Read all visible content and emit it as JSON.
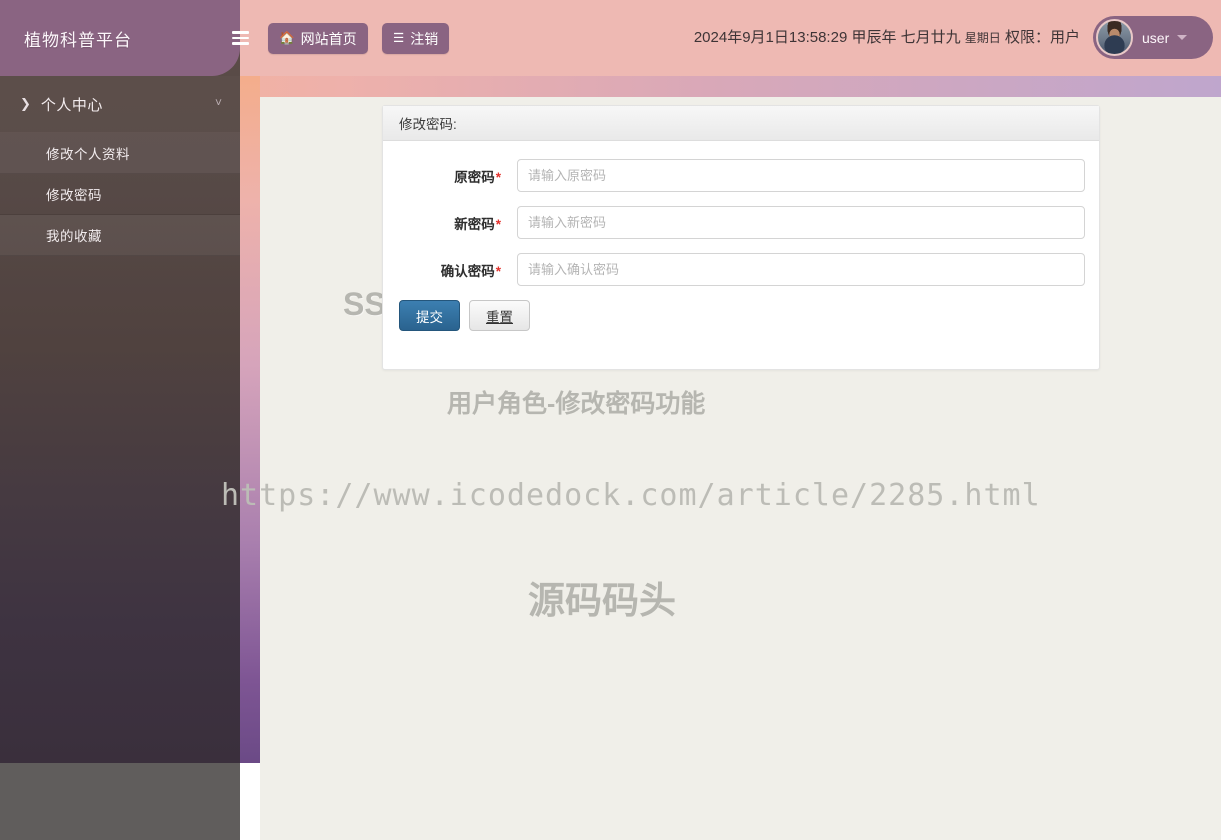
{
  "brand": {
    "logo_text": "植物科普平台"
  },
  "header": {
    "menu_toggle_icon": "hamburger-icon",
    "buttons": [
      {
        "label": "网站首页",
        "icon": "home-icon"
      },
      {
        "label": "注销",
        "icon": "list-icon"
      }
    ],
    "datetime": "2024年9月1日13:58:29 甲辰年 七月廿九",
    "weekday": "星期日",
    "role_label": "权限：用户",
    "user": {
      "name": "user",
      "avatar_icon": "user-avatar",
      "caret_icon": "caret-down-icon"
    }
  },
  "sidebar": {
    "group": {
      "label": "个人中心",
      "lead_icon": "chevron-right-icon",
      "trail_icon": "chevron-down-icon"
    },
    "items": [
      {
        "label": "修改个人资料"
      },
      {
        "label": "修改密码"
      },
      {
        "label": "我的收藏"
      }
    ]
  },
  "panel": {
    "title": "修改密码:",
    "fields": [
      {
        "label": "原密码",
        "required": "*",
        "placeholder": "请输入原密码",
        "value": ""
      },
      {
        "label": "新密码",
        "required": "*",
        "placeholder": "请输入新密码",
        "value": ""
      },
      {
        "label": "确认密码",
        "required": "*",
        "placeholder": "请输入确认密码",
        "value": ""
      }
    ],
    "submit_label": "提交",
    "reset_label": "重置"
  },
  "watermarks": {
    "title": "SSM在线植物宣传介绍推广科普平台",
    "subtitle": "用户角色-修改密码功能",
    "url": "https://www.icodedock.com/article/2285.html",
    "brand": "源码码头"
  },
  "colors": {
    "header_bg": "#eeb9b3",
    "brand_purple": "#8a6482",
    "page_bg": "#f0efe9",
    "primary_button": "#2a638f",
    "required_star": "#e3322d"
  }
}
